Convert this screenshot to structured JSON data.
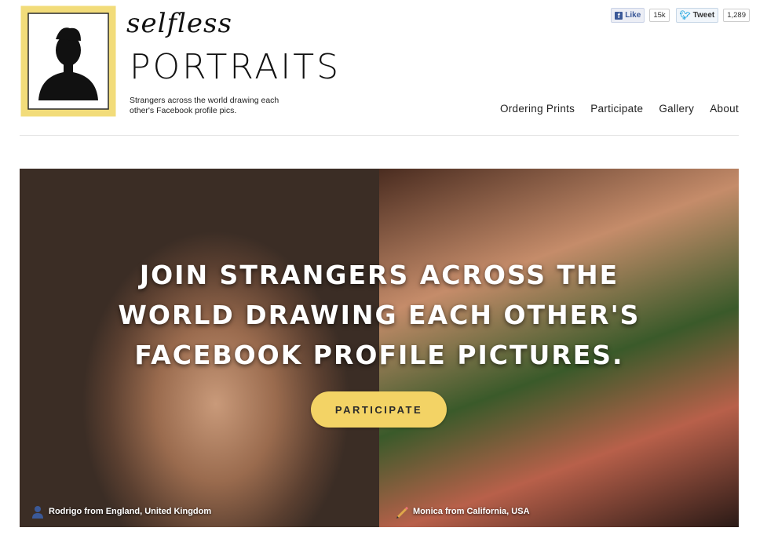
{
  "logo": {
    "title_top": "selfless",
    "title_main": "PORTRAITS",
    "tagline": "Strangers across the world drawing each other's Facebook profile pics."
  },
  "social": {
    "like_label": "Like",
    "like_count": "15k",
    "tweet_label": "Tweet",
    "tweet_count": "1,289"
  },
  "nav": {
    "items": [
      "Ordering Prints",
      "Participate",
      "Gallery",
      "About"
    ]
  },
  "hero": {
    "headline": [
      "JOIN STRANGERS ACROSS THE",
      "WORLD DRAWING EACH OTHER'S",
      "FACEBOOK PROFILE PICTURES."
    ],
    "cta_label": "PARTICIPATE",
    "caption_left": "Rodrigo from England, United Kingdom",
    "caption_right": "Monica from California, USA"
  },
  "colors": {
    "accent": "#f3d365",
    "frame": "#f2dc7a",
    "facebook": "#3b5998",
    "twitter": "#2aa9e0"
  }
}
